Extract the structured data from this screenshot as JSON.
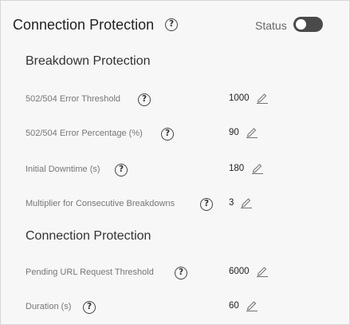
{
  "header": {
    "title": "Connection Protection",
    "status_label": "Status",
    "status_toggle": {
      "on": false
    }
  },
  "sections": [
    {
      "title": "Breakdown Protection",
      "fields": [
        {
          "label": "502/504 Error Threshold",
          "value": "1000"
        },
        {
          "label": "502/504 Error Percentage (%)",
          "value": "90"
        },
        {
          "label": "Initial Downtime (s)",
          "value": "180"
        },
        {
          "label": "Multiplier for Consecutive Breakdowns",
          "value": "3"
        }
      ]
    },
    {
      "title": "Connection Protection",
      "fields": [
        {
          "label": "Pending URL Request Threshold",
          "value": "6000"
        },
        {
          "label": "Duration (s)",
          "value": "60"
        }
      ]
    }
  ],
  "icons": {
    "help": "help-circle-icon",
    "edit": "pencil-edit-icon"
  },
  "colors": {
    "toggle_off": "#4a4a4a",
    "panel_background": "#f7f7f7"
  }
}
